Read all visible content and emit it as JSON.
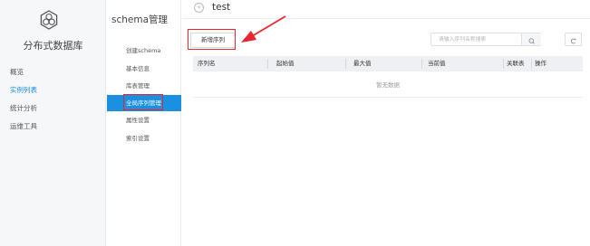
{
  "app": {
    "title": "分布式数据库",
    "logo_icon": "hexagon-cluster-logo"
  },
  "nav": {
    "items": [
      {
        "label": "概览",
        "active": false
      },
      {
        "label": "实例列表",
        "active": true
      },
      {
        "label": "统计分析",
        "active": false
      },
      {
        "label": "运维工具",
        "active": false
      }
    ]
  },
  "subnav": {
    "title": "schema管理",
    "items": [
      {
        "label": "创建schema",
        "active": false
      },
      {
        "label": "基本信息",
        "active": false
      },
      {
        "label": "库表管理",
        "active": false
      },
      {
        "label": "全局序列管理",
        "active": true
      },
      {
        "label": "属性设置",
        "active": false
      },
      {
        "label": "索引设置",
        "active": false
      }
    ]
  },
  "header": {
    "back_icon": "chevron-left-icon",
    "title": "test"
  },
  "toolbar": {
    "new_button": "新增序列",
    "search_placeholder": "请输入序列名称搜索",
    "search_icon": "search-icon",
    "refresh_icon": "refresh-icon"
  },
  "table": {
    "columns": [
      "序列名",
      "起始值",
      "最大值",
      "当前值",
      "关联表",
      "操作"
    ],
    "empty_text": "暂无数据"
  },
  "colors": {
    "accent": "#1b8fe0",
    "annotation": "#e8262b",
    "nav_bg": "#f6f7f9"
  }
}
